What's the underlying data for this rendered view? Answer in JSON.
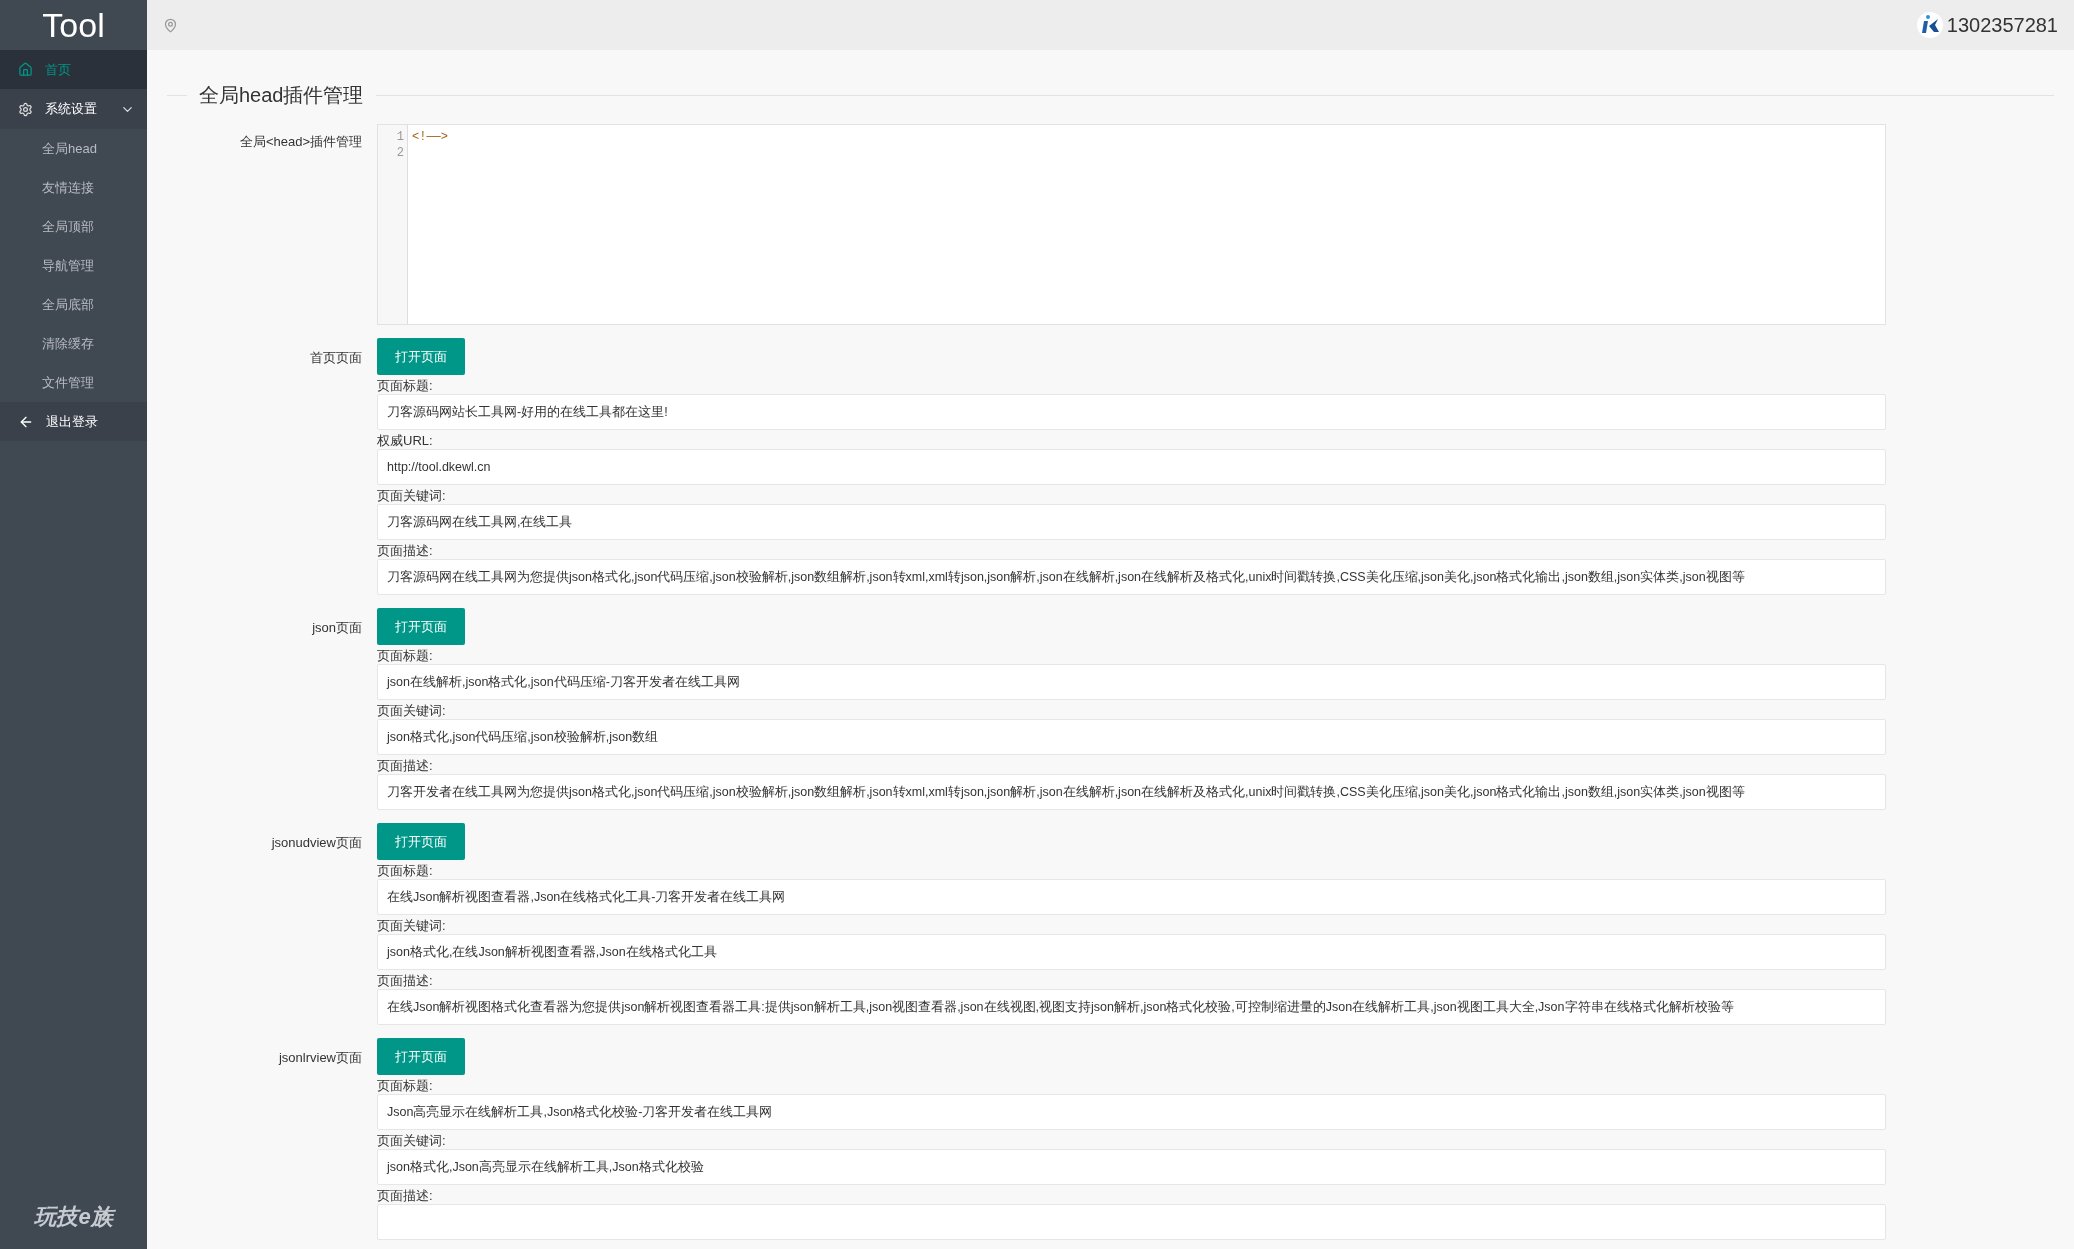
{
  "sidebar": {
    "logo": "Tool",
    "items": [
      {
        "kind": "link",
        "label": "首页",
        "selected": true
      },
      {
        "kind": "group",
        "label": "系统设置",
        "expanded": true,
        "children": [
          {
            "label": "全局head"
          },
          {
            "label": "友情连接"
          },
          {
            "label": "全局顶部"
          },
          {
            "label": "导航管理"
          },
          {
            "label": "全局底部"
          },
          {
            "label": "清除缓存"
          },
          {
            "label": "文件管理"
          }
        ]
      },
      {
        "kind": "link",
        "label": "退出登录",
        "selected": false
      }
    ],
    "footer_logo": "玩技e族"
  },
  "top_bar": {
    "username": "1302357281"
  },
  "section": {
    "title": "全局head插件管理",
    "editor": {
      "label": "全局<head>插件管理",
      "lines": [
        {
          "number": "1",
          "code": "<!——>"
        },
        {
          "number": "2"
        }
      ]
    },
    "pages": [
      {
        "label": "首页页面",
        "button": "打开页面",
        "fields": [
          {
            "label": "页面标题:",
            "value": "刀客源码网站长工具网-好用的在线工具都在这里!"
          },
          {
            "label": "权威URL:",
            "value": "http://tool.dkewl.cn"
          },
          {
            "label": "页面关键词:",
            "value": "刀客源码网在线工具网,在线工具"
          },
          {
            "label": "页面描述:",
            "value": "刀客源码网在线工具网为您提供json格式化,json代码压缩,json校验解析,json数组解析,json转xml,xml转json,json解析,json在线解析,json在线解析及格式化,unix时间戳转换,CSS美化压缩,json美化,json格式化输出,json数组,json实体类,json视图等"
          }
        ]
      },
      {
        "label": "json页面",
        "button": "打开页面",
        "fields": [
          {
            "label": "页面标题:",
            "value": "json在线解析,json格式化,json代码压缩-刀客开发者在线工具网"
          },
          {
            "label": "页面关键词:",
            "value": "json格式化,json代码压缩,json校验解析,json数组"
          },
          {
            "label": "页面描述:",
            "value": "刀客开发者在线工具网为您提供json格式化,json代码压缩,json校验解析,json数组解析,json转xml,xml转json,json解析,json在线解析,json在线解析及格式化,unix时间戳转换,CSS美化压缩,json美化,json格式化输出,json数组,json实体类,json视图等"
          }
        ]
      },
      {
        "label": "jsonudview页面",
        "button": "打开页面",
        "fields": [
          {
            "label": "页面标题:",
            "value": "在线Json解析视图查看器,Json在线格式化工具-刀客开发者在线工具网"
          },
          {
            "label": "页面关键词:",
            "value": "json格式化,在线Json解析视图查看器,Json在线格式化工具"
          },
          {
            "label": "页面描述:",
            "value": "在线Json解析视图格式化查看器为您提供json解析视图查看器工具:提供json解析工具,json视图查看器,json在线视图,视图支持json解析,json格式化校验,可控制缩进量的Json在线解析工具,json视图工具大全,Json字符串在线格式化解析校验等"
          }
        ]
      },
      {
        "label": "jsonlrview页面",
        "button": "打开页面",
        "fields": [
          {
            "label": "页面标题:",
            "value": "Json高亮显示在线解析工具,Json格式化校验-刀客开发者在线工具网"
          },
          {
            "label": "页面关键词:",
            "value": "json格式化,Json高亮显示在线解析工具,Json格式化校验"
          },
          {
            "label": "页面描述:"
          }
        ]
      }
    ]
  }
}
